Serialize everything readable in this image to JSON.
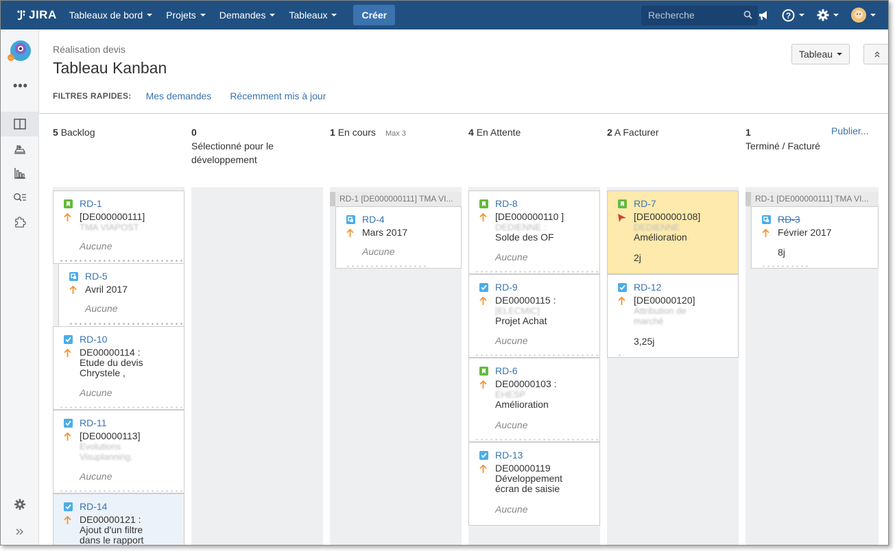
{
  "topbar": {
    "logo": "JIRA",
    "nav": [
      "Tableaux de bord",
      "Projets",
      "Demandes",
      "Tableaux"
    ],
    "create_label": "Créer",
    "search_placeholder": "Recherche"
  },
  "header": {
    "breadcrumb": "Réalisation devis",
    "title": "Tableau Kanban",
    "view_button": "Tableau",
    "filters_label": "FILTRES RAPIDES:",
    "filters": [
      "Mes demandes",
      "Récemment mis à jour"
    ]
  },
  "columns": [
    {
      "count": "5",
      "name": "Backlog"
    },
    {
      "count": "0",
      "name": "Sélectionné pour le développement"
    },
    {
      "count": "1",
      "name": "En cours",
      "max": "Max 3"
    },
    {
      "count": "4",
      "name": "En Attente"
    },
    {
      "count": "2",
      "name": "A Facturer"
    },
    {
      "count": "1",
      "name": "Terminé / Facturé",
      "action": "Publier..."
    }
  ],
  "swimlane_label": "RD-1  [DE000000111] TMA VI...",
  "cards": {
    "rd1": {
      "key": "RD-1",
      "l1": "[DE000000111]",
      "l2": "TMA VIAPOST",
      "footer": "Aucune"
    },
    "rd5": {
      "key": "RD-5",
      "l1": "Avril 2017",
      "footer": "Aucune"
    },
    "rd10": {
      "key": "RD-10",
      "l1": "DE00000114 :",
      "l2": "Etude du devis",
      "l3": "Chrystele ,",
      "footer": "Aucune"
    },
    "rd11": {
      "key": "RD-11",
      "l1": "[DE00000113]",
      "l2": "Evolutions",
      "l3": "Visuplanning.",
      "footer": "Aucune"
    },
    "rd14": {
      "key": "RD-14",
      "l1": "DE00000121 :",
      "l2": "Ajout d'un filtre",
      "l3": "dans le rapport"
    },
    "rd4": {
      "key": "RD-4",
      "l1": "Mars 2017",
      "footer": "Aucune"
    },
    "rd8": {
      "key": "RD-8",
      "l1": "[DE000000110 ]",
      "l2": "DEDIENNE :",
      "l3": "Solde des OF",
      "footer": "Aucune"
    },
    "rd9": {
      "key": "RD-9",
      "l1": "DE00000115 :",
      "l2": "[ELECMIC]",
      "l3": "Projet Achat",
      "footer": "Aucune"
    },
    "rd6": {
      "key": "RD-6",
      "l1": "DE00000103 :",
      "l2": "EHESP",
      "l3": "Amélioration",
      "footer": "Aucune"
    },
    "rd13": {
      "key": "RD-13",
      "l1": "DE00000119",
      "l2": "Développement",
      "l3": "écran de saisie",
      "footer": "Aucune"
    },
    "rd7": {
      "key": "RD-7",
      "l1": "[DE000000108]",
      "l2": "DEDIENNE",
      "l3": "Amélioration",
      "footer": "2j"
    },
    "rd12": {
      "key": "RD-12",
      "l1": "[DE00000120]",
      "l2": "Attribution de",
      "l3": "marché",
      "footer": "3,25j"
    },
    "rd3": {
      "key": "RD-3",
      "l1": "Février 2017",
      "footer": "8j"
    }
  },
  "colors": {
    "topbar": "#205081",
    "link": "#3b73af",
    "story": "#63ba3c",
    "task": "#4bade8",
    "bug": "#d04437",
    "priority": "#f79232"
  }
}
